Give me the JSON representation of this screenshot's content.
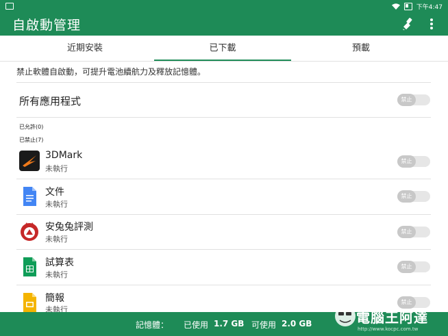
{
  "status_bar": {
    "time": "下午4:47"
  },
  "app_bar": {
    "title": "自啟動管理"
  },
  "tabs": [
    {
      "label": "近期安裝",
      "selected": false
    },
    {
      "label": "已下載",
      "selected": true
    },
    {
      "label": "預載",
      "selected": false
    }
  ],
  "description": "禁止軟體自啟動，可提升電池續航力及釋放記憶體。",
  "all_apps": {
    "label": "所有應用程式",
    "toggle": "禁止"
  },
  "sections": {
    "allowed": "已允許(0)",
    "blocked": "已禁止(7)"
  },
  "apps": [
    {
      "name": "3DMark",
      "status": "未執行",
      "toggle": "禁止",
      "icon": "3dmark-icon"
    },
    {
      "name": "文件",
      "status": "未執行",
      "toggle": "禁止",
      "icon": "docs-icon"
    },
    {
      "name": "安兔兔評測",
      "status": "未執行",
      "toggle": "禁止",
      "icon": "antutu-icon"
    },
    {
      "name": "試算表",
      "status": "未執行",
      "toggle": "禁止",
      "icon": "sheets-icon"
    },
    {
      "name": "簡報",
      "status": "未執行",
      "toggle": "禁止",
      "icon": "slides-icon"
    }
  ],
  "memory": {
    "label": "記憶體：",
    "used_label": "已使用",
    "used_value": "1.7 GB",
    "available_label": "可使用",
    "available_value": "2.0 GB"
  },
  "watermark": {
    "text": "電腦王阿達",
    "url": "http://www.kocpc.com.tw"
  },
  "colors": {
    "primary": "#1e8b57",
    "toggle_off": "#c8c8c8"
  }
}
